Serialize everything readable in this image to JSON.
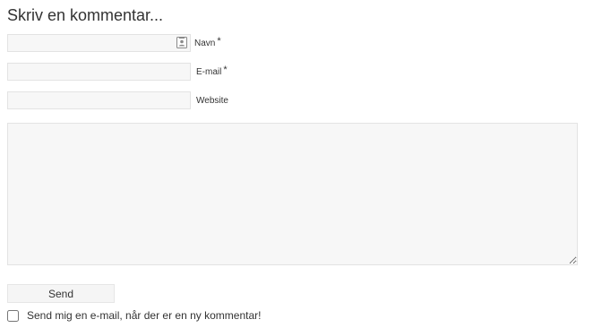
{
  "form": {
    "title": "Skriv en kommentar...",
    "fields": {
      "name": {
        "label": "Navn",
        "required_marker": "*",
        "value": "",
        "placeholder": "",
        "icon": "contact-card-icon"
      },
      "email": {
        "label": "E-mail",
        "required_marker": "*",
        "value": "",
        "placeholder": ""
      },
      "website": {
        "label": "Website",
        "value": "",
        "placeholder": ""
      }
    },
    "comment": {
      "value": "",
      "placeholder": ""
    },
    "send_label": "Send",
    "notify_label": "Send mig en e-mail, når der er en ny kommentar!",
    "notify_checked": false
  }
}
